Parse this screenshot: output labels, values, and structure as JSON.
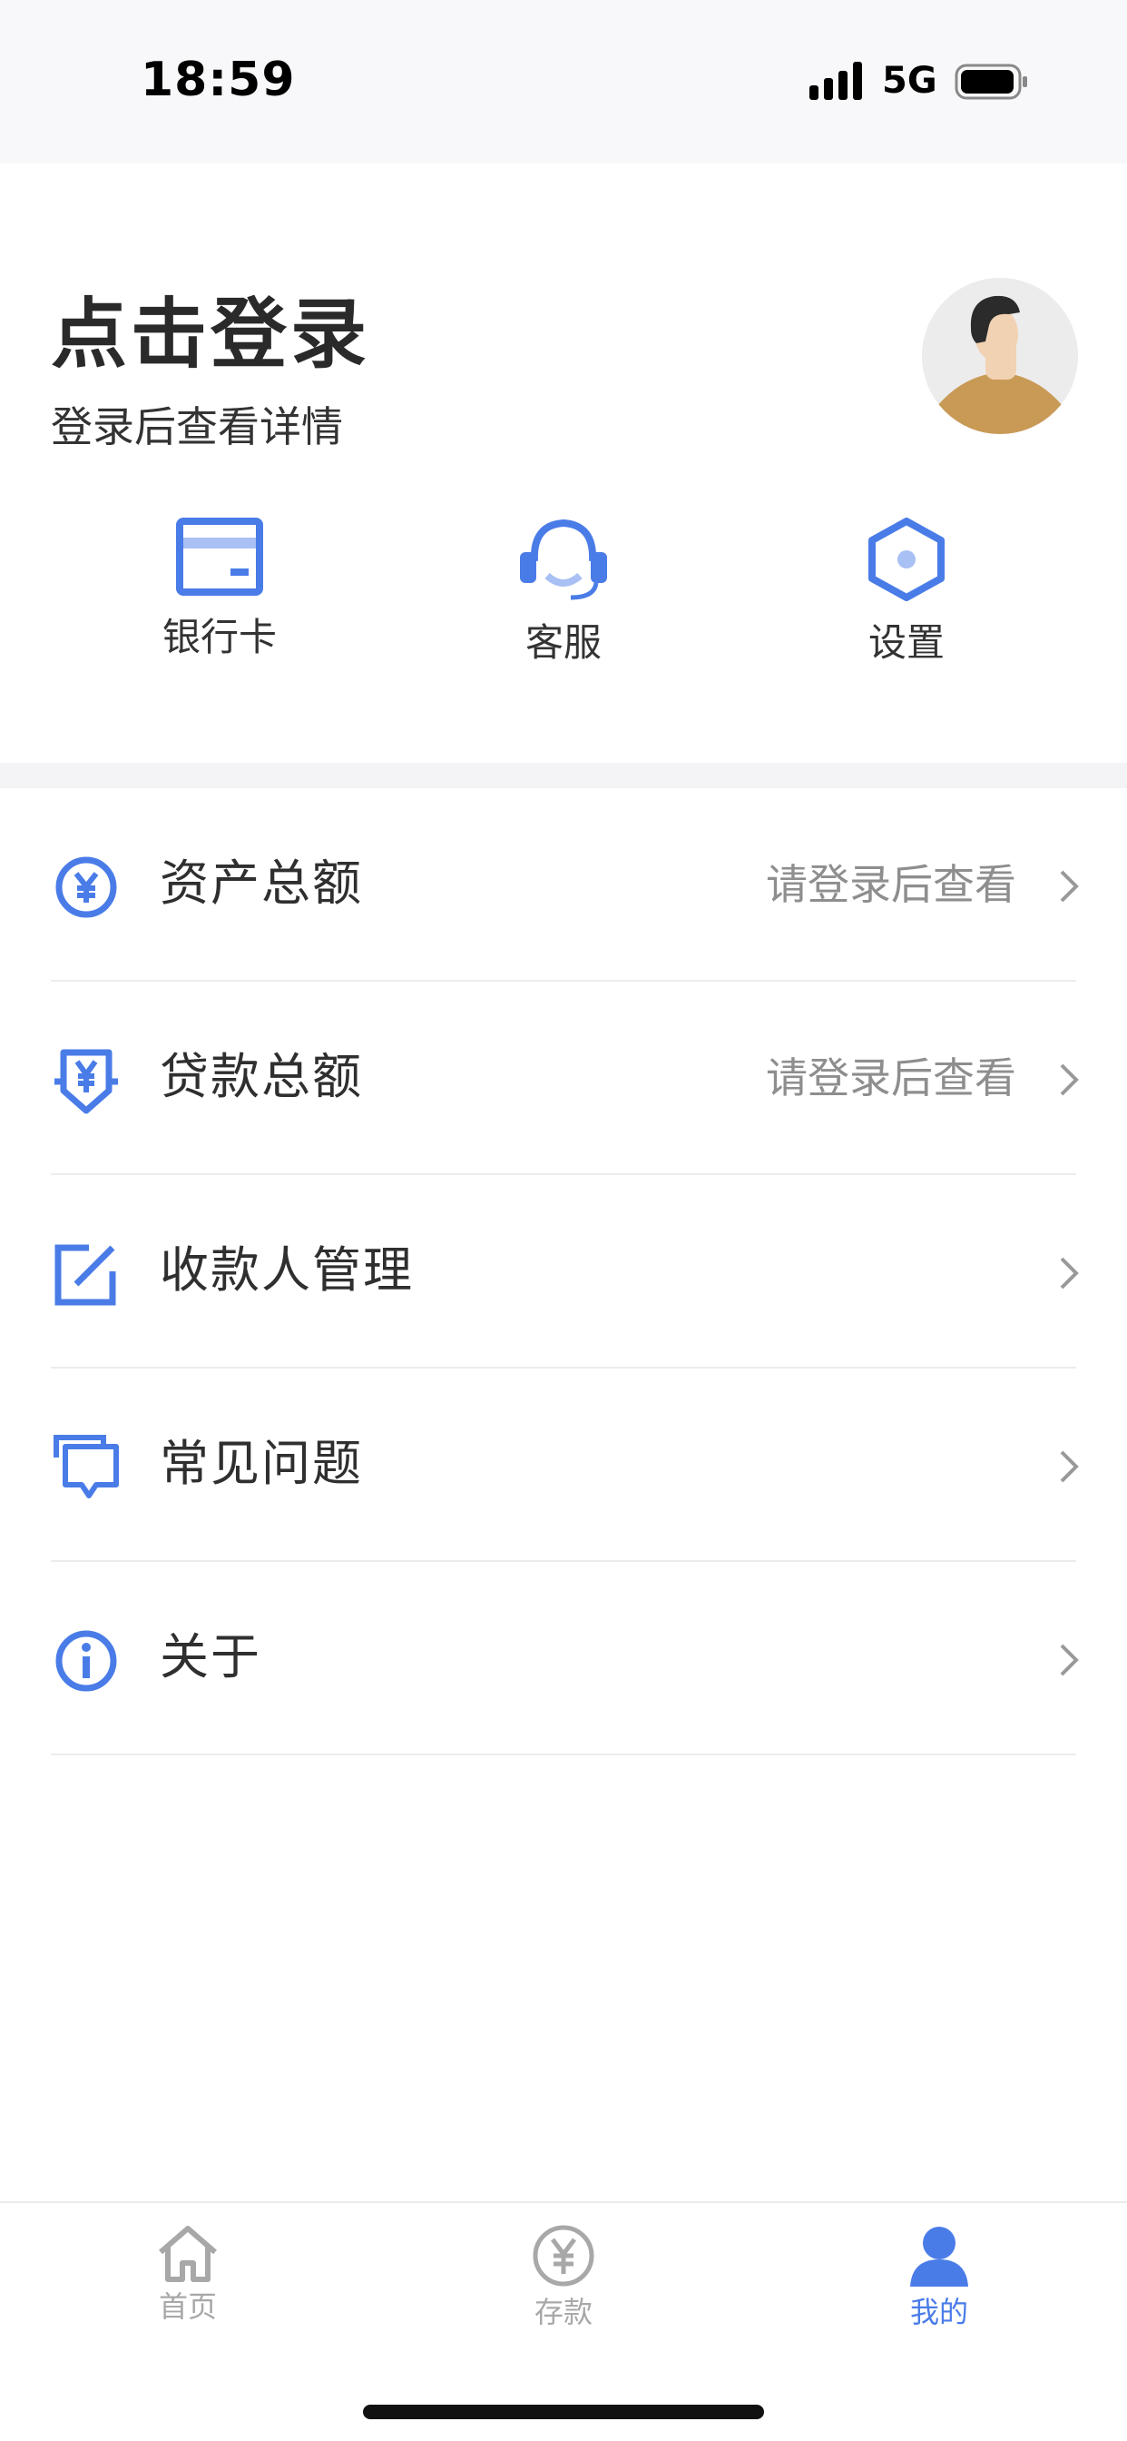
{
  "status_bar": {
    "time": "18:59",
    "network": "5G"
  },
  "header": {
    "title": "点击登录",
    "subtitle": "登录后查看详情",
    "avatar_icon": "user-avatar-icon"
  },
  "quick_actions": [
    {
      "label": "银行卡",
      "icon": "bank-card-icon"
    },
    {
      "label": "客服",
      "icon": "headset-icon"
    },
    {
      "label": "设置",
      "icon": "hexagon-settings-icon"
    }
  ],
  "menu": [
    {
      "label": "资产总额",
      "hint": "请登录后查看",
      "icon": "yen-circle-icon"
    },
    {
      "label": "贷款总额",
      "hint": "请登录后查看",
      "icon": "yen-shield-icon"
    },
    {
      "label": "收款人管理",
      "hint": "",
      "icon": "edit-icon"
    },
    {
      "label": "常见问题",
      "hint": "",
      "icon": "chat-icon"
    },
    {
      "label": "关于",
      "hint": "",
      "icon": "info-icon"
    }
  ],
  "tabbar": {
    "items": [
      {
        "label": "首页",
        "icon": "home-icon",
        "active": false
      },
      {
        "label": "存款",
        "icon": "yen-coin-icon",
        "active": false
      },
      {
        "label": "我的",
        "icon": "person-icon",
        "active": true
      }
    ]
  },
  "colors": {
    "accent": "#4a7ce8",
    "inactive": "#a8a8a8",
    "text": "#333333",
    "hint": "#8e8e8e"
  }
}
